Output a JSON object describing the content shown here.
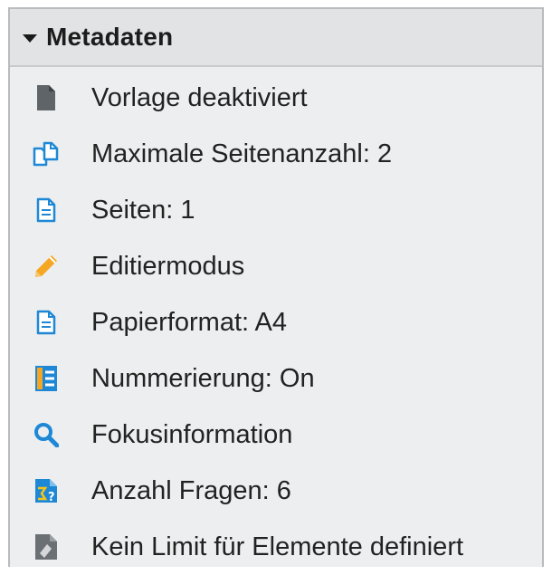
{
  "panel": {
    "title": "Metadaten",
    "expanded": true,
    "items": [
      {
        "icon": "document-gray-icon",
        "label": "Vorlage deaktiviert",
        "color": "#5f6468"
      },
      {
        "icon": "pages-copy-icon",
        "label": "Maximale Seitenanzahl: 2",
        "color": "#1e88d6"
      },
      {
        "icon": "document-blue-icon",
        "label": "Seiten: 1",
        "color": "#1e88d6"
      },
      {
        "icon": "pencil-icon",
        "label": "Editiermodus",
        "color": "#f5a623"
      },
      {
        "icon": "document-blue-icon",
        "label": "Papierformat: A4",
        "color": "#1e88d6"
      },
      {
        "icon": "numbered-list-icon",
        "label": "Nummerierung: On",
        "color": "#1e88d6"
      },
      {
        "icon": "search-icon",
        "label": "Fokusinformation",
        "color": "#1e88d6"
      },
      {
        "icon": "sum-question-icon",
        "label": "Anzahl Fragen: 6",
        "color": "#1e88d6"
      },
      {
        "icon": "elements-gray-icon",
        "label": "Kein Limit für Elemente definiert",
        "color": "#6b7075"
      }
    ]
  }
}
